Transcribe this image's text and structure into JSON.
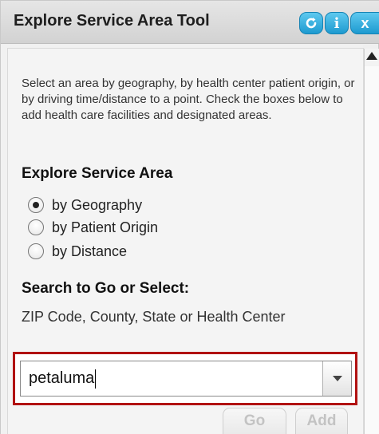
{
  "window": {
    "title": "Explore Service Area Tool",
    "buttons": {
      "refresh_icon": "refresh-icon",
      "info_glyph": "i",
      "close_glyph": "x"
    }
  },
  "intro_text": "Select an area by geography, by health center patient origin, or by driving time/distance to a point. Check the boxes below to add health care facilities and designated areas.",
  "explore": {
    "heading": "Explore Service Area",
    "options": [
      {
        "label": "by Geography",
        "checked": true
      },
      {
        "label": "by Patient Origin",
        "checked": false
      },
      {
        "label": "by Distance",
        "checked": false
      }
    ]
  },
  "search": {
    "heading": "Search to Go or Select:",
    "description": "ZIP Code, County, State or Health Center",
    "value": "petaluma"
  },
  "actions": {
    "go_label": "Go",
    "add_label": "Add"
  },
  "colors": {
    "accent": "#1d9ad0",
    "highlight": "#b11212"
  }
}
